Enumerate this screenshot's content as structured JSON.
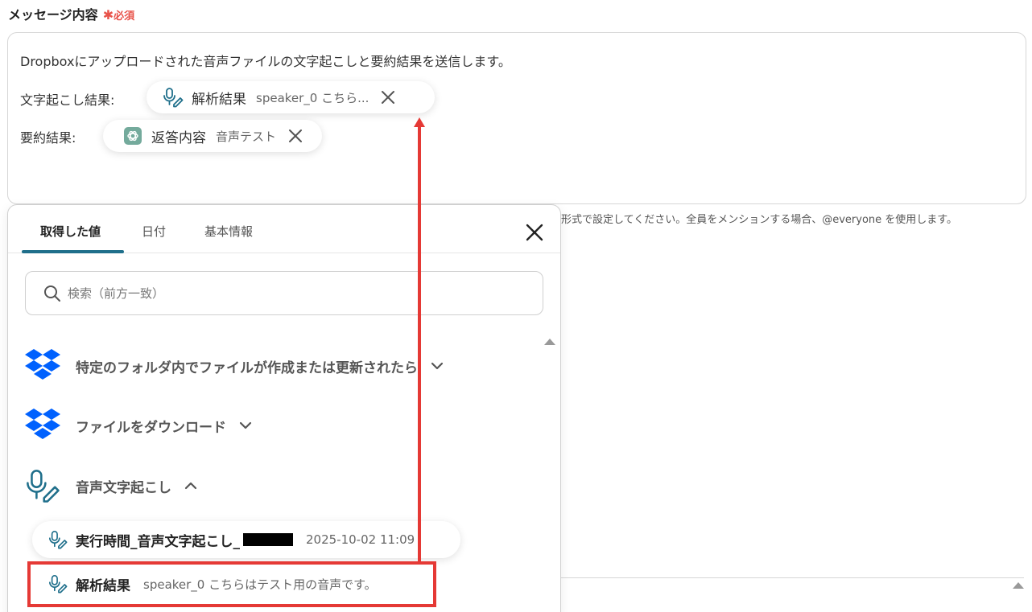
{
  "field": {
    "label": "メッセージ内容",
    "required_star": "✱",
    "required_text": "必須"
  },
  "message": {
    "line1": "Dropboxにアップロードされた音声ファイルの文字起こしと要約結果を送信します。",
    "line2_label": "文字起こし結果:",
    "line3_label": "要約結果:",
    "chip1": {
      "title": "解析結果",
      "subtitle": "speaker_0 こちら..."
    },
    "chip2": {
      "title": "返答内容",
      "subtitle": "音声テスト"
    }
  },
  "help_text": "形式で設定してください。全員をメンションする場合、@everyone を使用します。",
  "picker": {
    "tabs": [
      {
        "label": "取得した値",
        "active": true
      },
      {
        "label": "日付",
        "active": false
      },
      {
        "label": "基本情報",
        "active": false
      }
    ],
    "search_placeholder": "検索（前方一致）",
    "groups": [
      {
        "label": "特定のフォルダ内でファイルが作成または更新されたら",
        "icon": "dropbox-icon",
        "expanded": false
      },
      {
        "label": "ファイルをダウンロード",
        "icon": "dropbox-icon",
        "expanded": false
      },
      {
        "label": "音声文字起こし",
        "icon": "mic-pen-icon",
        "expanded": true
      }
    ],
    "items": [
      {
        "title": "実行時間_音声文字起こし_",
        "subtitle": "2025-10-02 11:09"
      },
      {
        "title": "解析結果",
        "subtitle": "speaker_0 こちらはテスト用の音声です。"
      }
    ]
  },
  "colors": {
    "accent": "#1f6f8b",
    "required": "#e8534a",
    "annotation": "#e53935",
    "dropbox": "#0061fe",
    "openai_bg": "#74aa9c"
  }
}
